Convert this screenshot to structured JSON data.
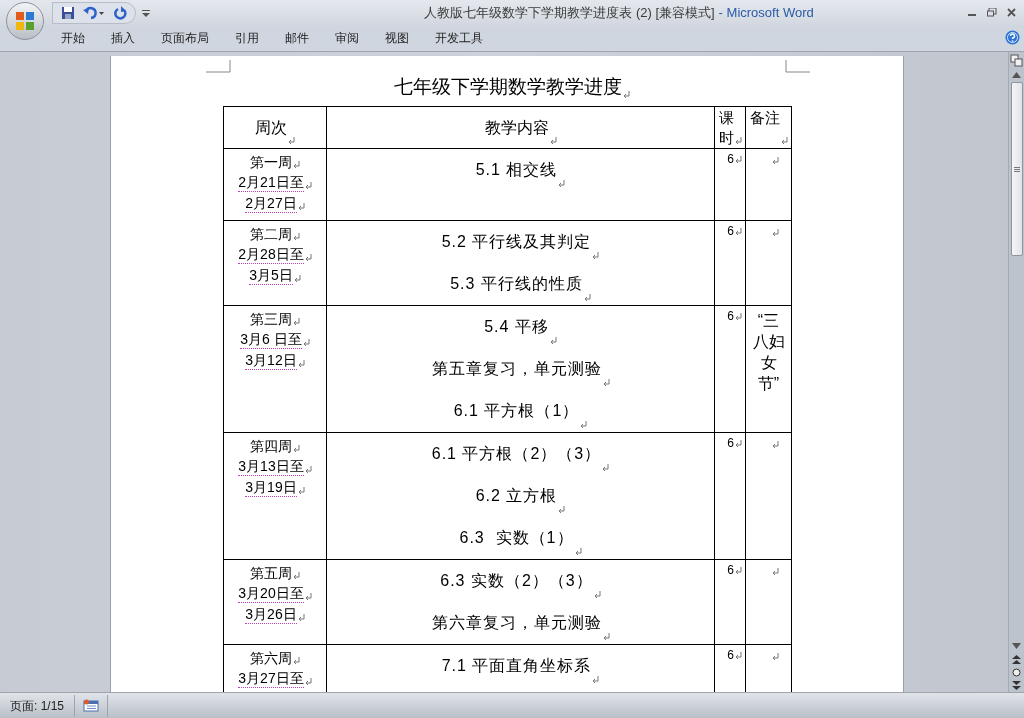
{
  "window": {
    "document_title": "人教版七年级数学下学期教学进度表 (2) [兼容模式]",
    "app_title": "- Microsoft Word"
  },
  "ribbon_tabs": [
    "开始",
    "插入",
    "页面布局",
    "引用",
    "邮件",
    "审阅",
    "视图",
    "开发工具"
  ],
  "document": {
    "title": "七年级下学期数学教学进度",
    "table": {
      "columns": [
        "周次",
        "教学内容",
        "课时",
        "备注"
      ],
      "rows": [
        {
          "week": "第一周",
          "dates": [
            "2月21日至",
            "2月27日"
          ],
          "content": [
            "5.1 相交线"
          ],
          "hours": "6"
        },
        {
          "week": "第二周",
          "dates": [
            "2月28日至",
            "3月5日"
          ],
          "content": [
            "5.2 平行线及其判定",
            "5.3 平行线的性质"
          ],
          "hours": "6"
        },
        {
          "week": "第三周",
          "dates": [
            "3月6 日至",
            "3月12日"
          ],
          "content": [
            "5.4 平移",
            "第五章复习，单元测验",
            "6.1 平方根（1）"
          ],
          "hours": "6",
          "note": "“三八妇女节”"
        },
        {
          "week": "第四周",
          "dates": [
            "3月13日至",
            "3月19日"
          ],
          "content": [
            "6.1 平方根（2）（3）",
            "6.2 立方根",
            "6.3  实数（1）"
          ],
          "hours": "6"
        },
        {
          "week": "第五周",
          "dates": [
            "3月20日至",
            "3月26日"
          ],
          "content": [
            "6.3 实数（2）（3）",
            "第六章复习，单元测验"
          ],
          "hours": "6"
        },
        {
          "week": "第六周",
          "dates": [
            "3月27日至"
          ],
          "content": [
            "7.1 平面直角坐标系"
          ],
          "hours": "6"
        }
      ]
    }
  },
  "status_bar": {
    "page": "页面: 1/15"
  }
}
